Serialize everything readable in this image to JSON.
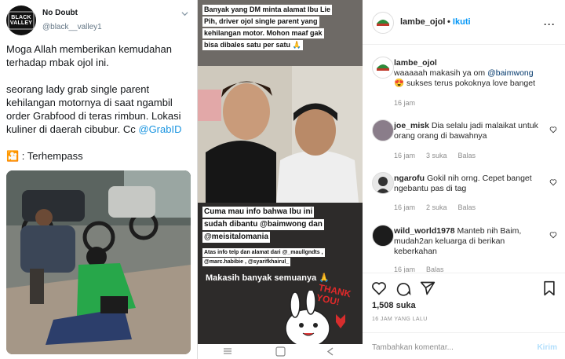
{
  "tweet": {
    "avatar_logo": "BLACK VALLEY",
    "name": "No Doubt",
    "handle": "@black__valley1",
    "para1": "Moga Allah memberikan kemudahan terhadap mbak ojol ini.",
    "para2_text": "seorang lady grab single parent kehilangan motornya di saat ngambil order Grabfood di teras rimbun. Lokasi kuliner di daerah cibubur. Cc ",
    "para2_link": "@GrabID",
    "para3": "🎦 : Terhempass"
  },
  "story": {
    "top_text": [
      "Banyak yang DM minta alamat Ibu Lie",
      "Pih, driver ojol single parent yang",
      "kehilangan motor. Mohon maaf gak",
      "bisa dibales satu per satu 🙏"
    ],
    "mid_text": [
      "Cuma mau info bahwa Ibu ini",
      "sudah dibantu @baimwong dan",
      "@meisitalomania"
    ],
    "small_text": [
      "Atas info telp dan alamat dari @_maullgndts ,",
      "@marc.habibie , @syarifkhairul_"
    ],
    "thanks_text": "Makasih banyak semuanya 🙏",
    "sticker_text": "THANK YOU!"
  },
  "instagram": {
    "username": "lambe_ojol",
    "follow_label": "Ikuti",
    "dots": "···",
    "caption": {
      "user": "lambe_ojol",
      "line1": "waaaaah makasih ya om ",
      "mention": "@baimwong",
      "line2": "😍 sukses terus pokoknya love banget",
      "time": "16 jam"
    },
    "comments": [
      {
        "user": "joe_misk",
        "text": "Dia selalu jadi malaikat untuk orang orang di bawahnya",
        "time": "16 jam",
        "likes": "3 suka",
        "reply": "Balas"
      },
      {
        "user": "ngarofu",
        "text": "Gokil nih orng. Cepet banget ngebantu pas di tag",
        "time": "16 jam",
        "likes": "2 suka",
        "reply": "Balas"
      },
      {
        "user": "wild_world1978",
        "text": "Manteb nih Baim, mudah2an keluarga di berikan keberkahan",
        "time": "16 jam",
        "likes": "",
        "reply": "Balas"
      }
    ],
    "likes": "1,508 suka",
    "date": "16 JAM YANG LALU",
    "add_comment_placeholder": "Tambahkan komentar...",
    "post_label": "Kirim"
  }
}
